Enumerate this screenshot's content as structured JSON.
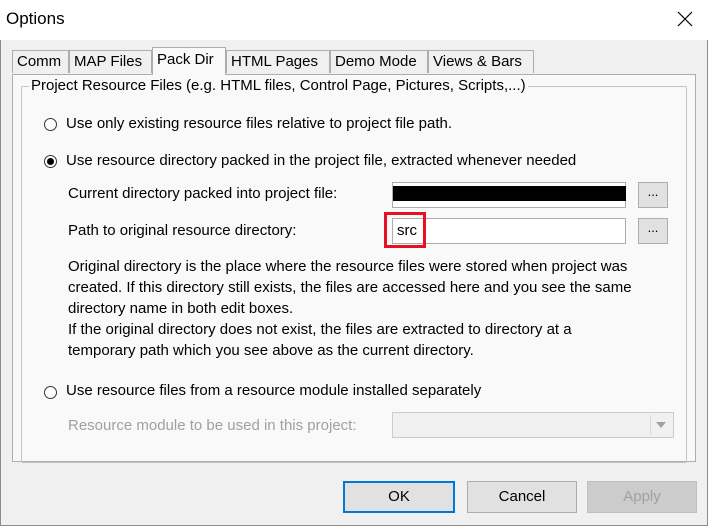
{
  "window": {
    "title": "Options",
    "close_icon": "close-icon"
  },
  "tabs": [
    {
      "label": "Comm"
    },
    {
      "label": "MAP Files"
    },
    {
      "label": "Pack Dir",
      "active": true
    },
    {
      "label": "HTML Pages"
    },
    {
      "label": "Demo Mode"
    },
    {
      "label": "Views & Bars"
    }
  ],
  "group": {
    "legend": "Project Resource Files (e.g. HTML files, Control Page, Pictures, Scripts,...)"
  },
  "options": {
    "opt1_label": "Use only existing resource files relative to project file path.",
    "opt1_selected": false,
    "opt2_label": "Use resource directory packed in the project file, extracted whenever needed",
    "opt2_selected": true,
    "opt3_label": "Use resource files from a resource module installed separately",
    "opt3_selected": false
  },
  "fields": {
    "current_dir_label": "Current directory packed into project file:",
    "current_dir_value": "",
    "original_path_label": "Path to original resource directory:",
    "original_path_value": "src",
    "browse_label": "...",
    "module_label": "Resource module to be used in this project:",
    "module_value": ""
  },
  "description": {
    "line1": "Original directory is the place where the resource files were stored when project was",
    "line2": "created. If this directory still exists, the files are accessed here and you see the same",
    "line3": "directory name in both edit boxes.",
    "line4": "If the original directory does not exist, the files are extracted to directory at a",
    "line5": "temporary path which you see above as the current directory."
  },
  "buttons": {
    "ok": "OK",
    "cancel": "Cancel",
    "apply": "Apply"
  },
  "colors": {
    "highlight_box": "#e81123",
    "default_button_border": "#0078d7",
    "redaction": "#000000"
  }
}
